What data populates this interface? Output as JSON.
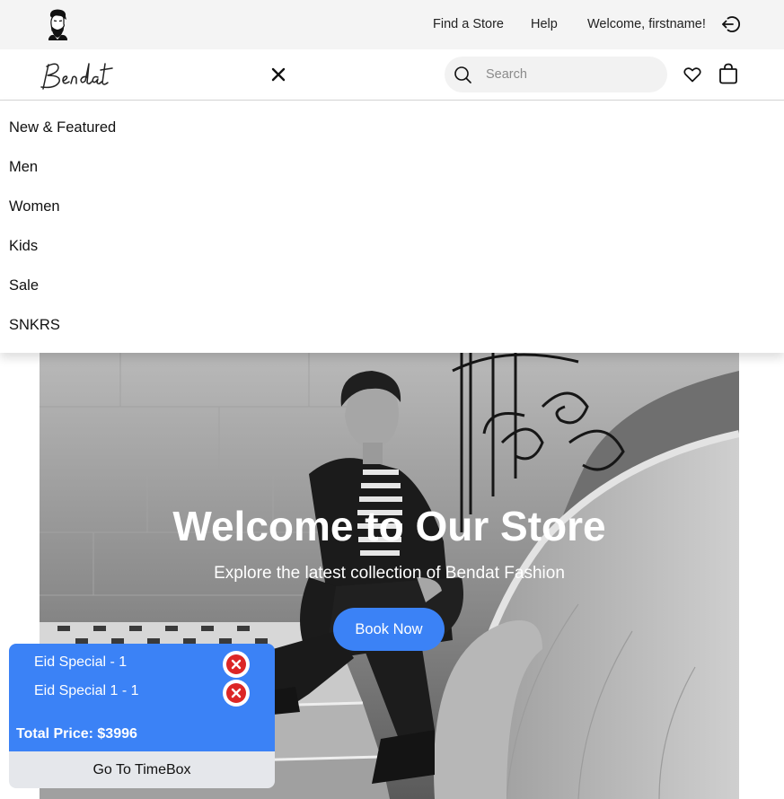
{
  "top_bar": {
    "brand_icon": "bearded-man-portrait",
    "links": [
      "Find a Store",
      "Help"
    ],
    "welcome": "Welcome, firstname!",
    "logout_icon": "logout-icon"
  },
  "nav": {
    "logo": "Bendat",
    "close_icon": "close-icon",
    "search_placeholder": "Search",
    "search_value": "",
    "wishlist_icon": "heart-icon",
    "bag_icon": "shopping-bag-icon"
  },
  "menu": {
    "items": [
      "New & Featured",
      "Men",
      "Women",
      "Kids",
      "Sale",
      "SNKRS"
    ]
  },
  "hero": {
    "title": "Welcome to Our Store",
    "subtitle": "Explore the latest collection of Bendat Fashion",
    "cta": "Book Now",
    "image": "black-and-white photo of a man in a leather jacket seated on stone stairs"
  },
  "cart": {
    "items": [
      {
        "name": "Eid Special - 1"
      },
      {
        "name": "Eid Special 1 - 1"
      }
    ],
    "total": "Total Price: $3996",
    "button": "Go To TimeBox"
  },
  "colors": {
    "accent": "#3b82f6",
    "remove": "#dc2626",
    "top_bar_bg": "#f4f4f4",
    "search_bg": "#f2f2f2"
  }
}
